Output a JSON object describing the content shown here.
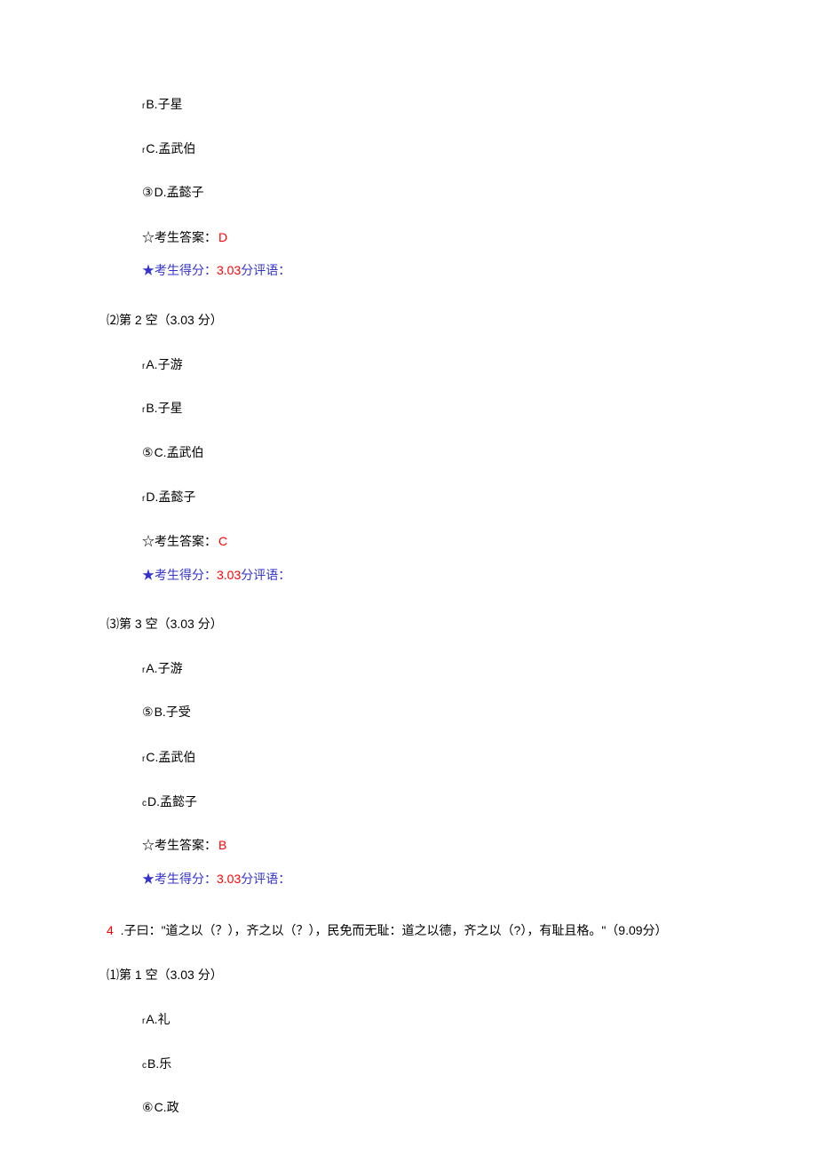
{
  "block1": {
    "options": [
      {
        "marker": "r",
        "markerCircled": false,
        "label": "B.子星"
      },
      {
        "marker": "r",
        "markerCircled": false,
        "label": "C.孟武伯"
      },
      {
        "marker": "③",
        "markerCircled": true,
        "label": "D.孟懿子"
      }
    ],
    "answerPrefix": "☆考生答案：",
    "answerValue": "D",
    "scorePrefix": "★考生得分：",
    "scoreValue": "3.03",
    "scoreSuffix": "分评语："
  },
  "block2": {
    "heading": "⑵第 2 空（3.03 分）",
    "options": [
      {
        "marker": "r",
        "markerCircled": false,
        "label": "A.子游"
      },
      {
        "marker": "r",
        "markerCircled": false,
        "label": "B.子星"
      },
      {
        "marker": "⑤",
        "markerCircled": true,
        "label": "C.孟武伯"
      },
      {
        "marker": "r",
        "markerCircled": false,
        "label": "D.孟懿子"
      }
    ],
    "answerPrefix": "☆考生答案：",
    "answerValue": "C",
    "scorePrefix": "★考生得分：",
    "scoreValue": "3.03",
    "scoreSuffix": "分评语："
  },
  "block3": {
    "heading": "⑶第 3 空（3.03 分）",
    "options": [
      {
        "marker": "r",
        "markerCircled": false,
        "label": "A.子游"
      },
      {
        "marker": "⑤",
        "markerCircled": true,
        "label": "B.子受"
      },
      {
        "marker": "r",
        "markerCircled": false,
        "label": "C.孟武伯"
      },
      {
        "marker": "c",
        "markerCircled": false,
        "label": "D.孟懿子"
      }
    ],
    "answerPrefix": "☆考生答案：",
    "answerValue": "B",
    "scorePrefix": "★考生得分：",
    "scoreValue": "3.03",
    "scoreSuffix": "分评语："
  },
  "question4": {
    "num": "4",
    "text": " .子曰：\"道之以（？），齐之以（？），民免而无耻：道之以德，齐之以（?），有耻且格。\"（9.09分）"
  },
  "block4": {
    "heading": "⑴第 1 空（3.03 分）",
    "options": [
      {
        "marker": "r",
        "markerCircled": false,
        "label": "A.礼"
      },
      {
        "marker": "c",
        "markerCircled": false,
        "label": "B.乐"
      },
      {
        "marker": "⑥",
        "markerCircled": true,
        "label": "C.政"
      }
    ]
  }
}
